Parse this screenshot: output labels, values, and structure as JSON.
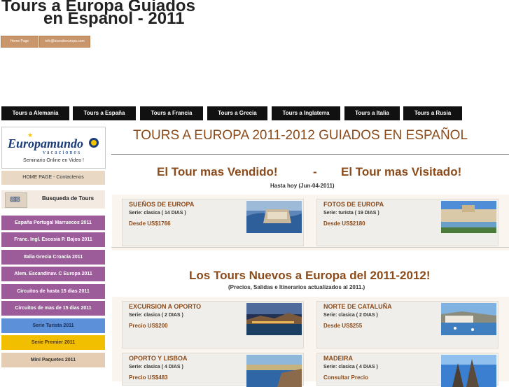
{
  "header": {
    "title_line1": "Tours a Europa Guiados",
    "title_line2": "en Espanol - 2011",
    "home_btn": "Home Page",
    "email_btn": "info@toursdeeuropa.com"
  },
  "nav": [
    "Tours a Alemania",
    "Tours a España",
    "Tours a Francia",
    "Tours a Grecia",
    "Tours a Inglaterra",
    "Tours a Italia",
    "Tours a Rusia"
  ],
  "sidebar": {
    "logo": "Europamundo",
    "logo_sub": "vacaciones",
    "caption": "Seminario Online en Video !",
    "home": "HOME PAGE   -   Contactenos",
    "search": "Busqueda de Tours",
    "items": [
      "España Portugal Marruecos 2011",
      "Franc. Ingl. Escosia P. Bajos 2011",
      "Italia Grecia Croacia 2011",
      "Alem. Escandinav. C Europa 2011",
      "Circuitos de hasta 15 dias 2011",
      "Circuitos de mas de 15 dias 2011",
      "Serie Turista 2011",
      "Serie Premier 2011",
      "Mini Paquetes 2011"
    ]
  },
  "main": {
    "title": "TOURS A EUROPA 2011-2012 GUIADOS EN ESPAÑOL",
    "best_seller": "El Tour mas Vendido!",
    "dash": "-",
    "most_visited": "El Tour mas Visitado!",
    "as_of": "Hasta hoy (Jun-04-2011)",
    "new_heading": "Los Tours Nuevos a Europa del 2011-2012!",
    "new_note": "(Precios, Salidas e Itinerarios actualizados al 2011.)",
    "cards": [
      {
        "title": "SUEÑOS DE EUROPA",
        "serie": "Serie: clasica ( 14 DIAS )",
        "price": "Desde US$1766"
      },
      {
        "title": "FOTOS DE EUROPA",
        "serie": "Serie: turista ( 19 DIAS )",
        "price": "Desde US$2180"
      },
      {
        "title": "EXCURSION A OPORTO",
        "serie": "Serie: clasica ( 2 DIAS )",
        "price": "Precio US$200"
      },
      {
        "title": "NORTE DE CATALUÑA",
        "serie": "Serie: clasica ( 2 DIAS )",
        "price": "Desde US$255"
      },
      {
        "title": "OPORTO Y LISBOA",
        "serie": "Serie: clasica ( 4 DIAS )",
        "price": "Precio US$483"
      },
      {
        "title": "MADEIRA",
        "serie": "Serie: clasica ( 4 DIAS )",
        "price": "Consultar Precio"
      }
    ]
  }
}
